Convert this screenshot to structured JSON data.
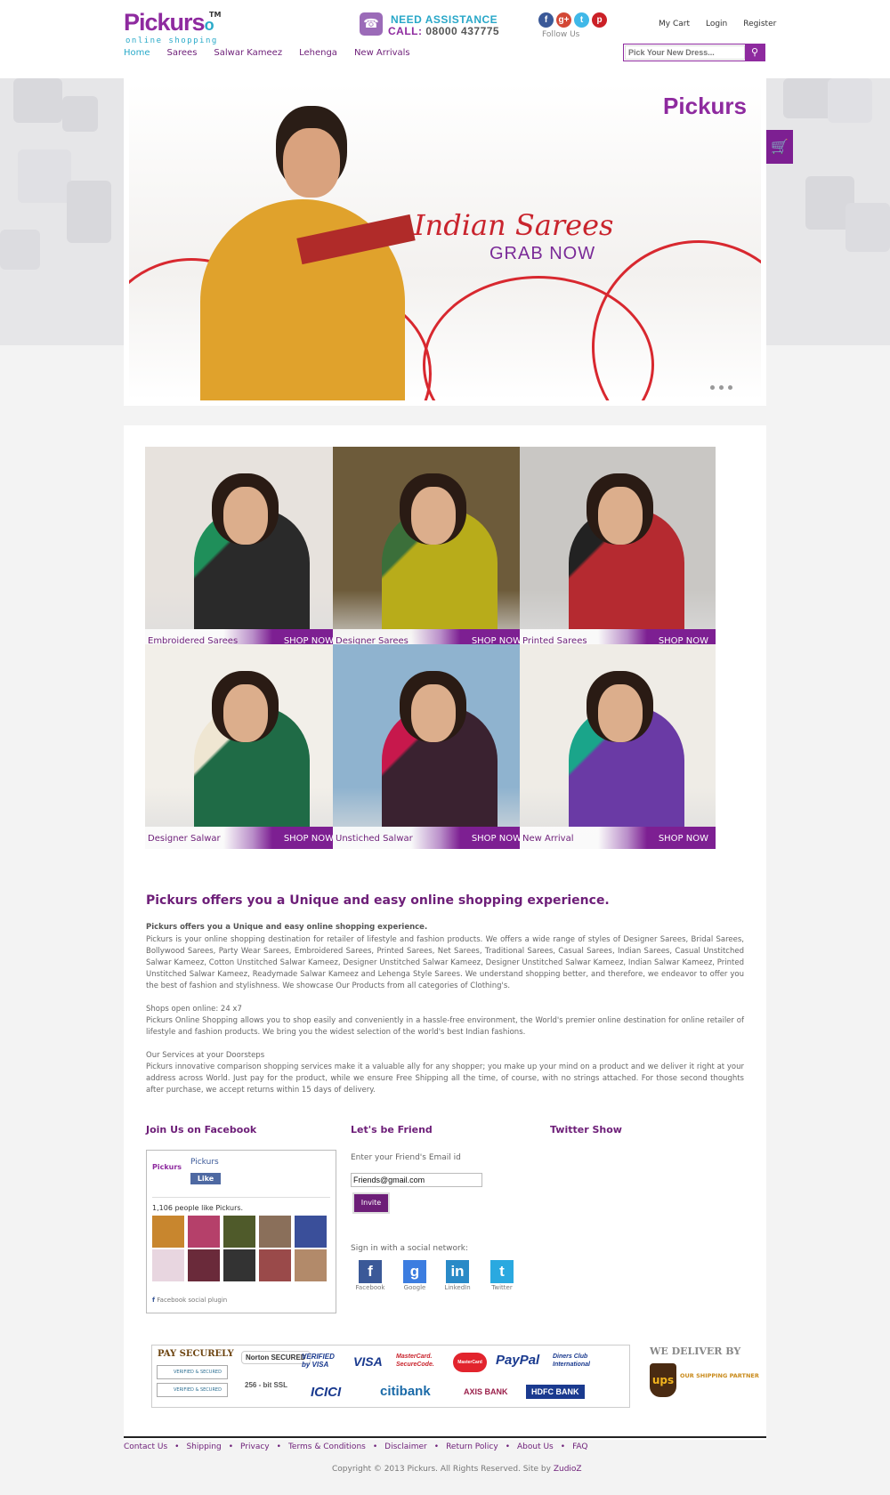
{
  "header": {
    "logo_text": "Pickurs",
    "logo_suffix": "o",
    "logo_tm": "TM",
    "logo_tagline": "online shopping",
    "assist_line1": "NEED  ASSISTANCE",
    "assist_call": "CALL:",
    "assist_number": "08000  437775",
    "follow_label": "Follow Us",
    "social": [
      {
        "icon": "facebook-icon",
        "glyph": "f",
        "color": "#3b5998"
      },
      {
        "icon": "google-plus-icon",
        "glyph": "g+",
        "color": "#d34836"
      },
      {
        "icon": "twitter-icon",
        "glyph": "t",
        "color": "#40b8e8"
      },
      {
        "icon": "pinterest-icon",
        "glyph": "p",
        "color": "#cb2027"
      }
    ],
    "toplinks": [
      "My Cart",
      "Login",
      "Register"
    ],
    "nav": [
      "Home",
      "Sarees",
      "Salwar Kameez",
      "Lehenga",
      "New Arrivals"
    ],
    "search_placeholder": "Pick Your New Dress...",
    "search_value": "Pick Your New Dress..."
  },
  "banner": {
    "logo": "Pickurs",
    "title": "Indian Sarees",
    "subtitle": "GRAB NOW"
  },
  "tiles": [
    {
      "label": "Embroidered Sarees",
      "shop": "SHOP NOW",
      "bg": "#e7e2dd",
      "garment": "#2a2a2a",
      "accent": "#1f8f5a"
    },
    {
      "label": "Designer  Sarees",
      "shop": "SHOP NOW",
      "bg": "#6d5b3a",
      "garment": "#b8ac1a",
      "accent": "#3b6f3a"
    },
    {
      "label": "Printed Sarees",
      "shop": "SHOP NOW",
      "bg": "#c9c7c4",
      "garment": "#b52a30",
      "accent": "#222"
    },
    {
      "label": "Designer  Salwar",
      "shop": "SHOP NOW",
      "bg": "#f2efe9",
      "garment": "#1f6b46",
      "accent": "#efe6d2"
    },
    {
      "label": "Unstiched Salwar",
      "shop": "SHOP NOW",
      "bg": "#8fb3cf",
      "garment": "#3a2230",
      "accent": "#c7184c"
    },
    {
      "label": "New Arrival",
      "shop": "SHOP NOW",
      "bg": "#efece6",
      "garment": "#6a3aa5",
      "accent": "#1aa58a"
    }
  ],
  "about": {
    "title": "Pickurs offers you a Unique and easy online shopping experience.",
    "heading1": "Pickurs offers you a Unique and easy online shopping experience.",
    "para1": "Pickurs is your online shopping destination for retailer of lifestyle and fashion products. We offers a wide range of styles of Designer Sarees, Bridal Sarees, Bollywood Sarees, Party Wear Sarees, Embroidered Sarees, Printed Sarees, Net Sarees, Traditional Sarees, Casual Sarees, Indian Sarees, Casual Unstitched Salwar Kameez, Cotton Unstitched Salwar Kameez, Designer Unstitched Salwar Kameez, Designer Unstitched Salwar Kameez, Indian Salwar Kameez, Printed Unstitched Salwar Kameez, Readymade Salwar Kameez and Lehenga Style Sarees. We understand shopping better, and therefore, we endeavor to offer you the best of fashion and stylishness. We showcase Our Products from all categories of Clothing's.",
    "heading2": "Shops open online: 24 x7",
    "para2": "Pickurs Online Shopping allows you to shop easily and conveniently in a hassle-free environment, the World's premier online destination for online retailer of lifestyle and fashion products. We bring you the widest selection of the world's best Indian fashions.",
    "heading3": "Our Services at your Doorsteps",
    "para3": "Pickurs innovative comparison shopping services make it a valuable ally for any shopper; you make up your mind on a product and we deliver it right at your address across World. Just pay for the product, while we ensure Free Shipping all the time, of course, with no strings attached. For those second thoughts after purchase, we accept returns within 15 days of delivery."
  },
  "social_cols": {
    "facebook_title": "Join Us on Facebook",
    "friend_title": "Let's be Friend",
    "twitter_title": "Twitter Show"
  },
  "facebook": {
    "page_logo": "Pickurs",
    "page_name": "Pickurs",
    "like_label": "Like",
    "count_text": "1,106 people like Pickurs.",
    "plugin_label": "Facebook social plugin",
    "fans": [
      "#c8862e",
      "#b5406a",
      "#4f5a2a",
      "#8a6f5a",
      "#3a4f9a",
      "#e8d6e0",
      "#6a2a3a",
      "#333",
      "#9a4a4a",
      "#b28a6a"
    ]
  },
  "friend": {
    "label": "Enter your Friend's Email id",
    "email_value": "Friends@gmail.com",
    "invite_label": "Invite",
    "signin_label": "Sign in with a social network:",
    "networks": [
      {
        "name": "Facebook",
        "glyph": "f",
        "color": "#3b5998",
        "icon": "facebook-icon"
      },
      {
        "name": "Google",
        "glyph": "g",
        "color": "#3c7de0",
        "icon": "google-icon"
      },
      {
        "name": "LinkedIn",
        "glyph": "in",
        "color": "#2a8ac7",
        "icon": "linkedin-icon"
      },
      {
        "name": "Twitter",
        "glyph": "t",
        "color": "#2aa9e0",
        "icon": "twitter-icon"
      }
    ]
  },
  "payments": {
    "title": "PAY SECURELY",
    "badge1": "VERIFIED & SECURED",
    "badge2": "VERIFIED & SECURED",
    "norton": "Norton SECURED",
    "ssl": "256 - bit SSL",
    "row1": [
      "VERIFIED by VISA",
      "VISA",
      "MasterCard. SecureCode.",
      "MasterCard",
      "PayPal",
      "Diners Club International"
    ],
    "row2": [
      "ICICI",
      "citibank",
      "AXIS BANK",
      "HDFC BANK"
    ],
    "deliver_title": "WE DELIVER BY",
    "ups": "ups",
    "ups_text": "OUR SHIPPING PARTNER"
  },
  "footer": {
    "links": [
      "Contact Us",
      "Shipping",
      "Privacy",
      "Terms & Conditions",
      "Disclaimer",
      "Return Policy",
      "About Us",
      "FAQ"
    ],
    "copyright": "Copyright © 2013 Pickurs. All Rights Reserved. Site by",
    "site_by": "ZudioZ"
  }
}
